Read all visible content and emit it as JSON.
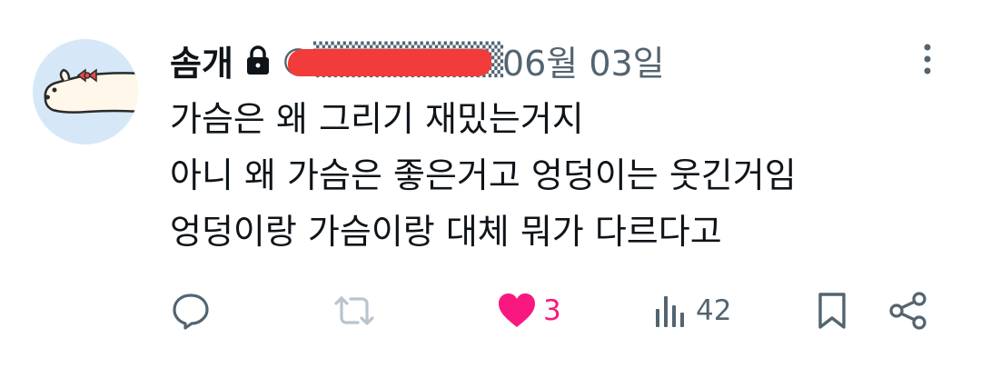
{
  "tweet": {
    "author_name": "솜개",
    "handle": "@▒▒▒▒▒▒▒▒",
    "date": "06월 03일",
    "lines": [
      "가슴은 왜 그리기 재밌는거지",
      "아니 왜 가슴은 좋은거고 엉덩이는 웃긴거임",
      "엉덩이랑 가슴이랑 대체 뭐가 다르다고"
    ]
  },
  "actions": {
    "likes": "3",
    "views": "42"
  },
  "icons": {
    "protected": "lock-icon",
    "more": "more-vertical-icon",
    "reply": "reply-icon",
    "retweet": "retweet-icon",
    "like": "heart-icon",
    "views": "views-chart-icon",
    "bookmark": "bookmark-icon",
    "share": "share-icon"
  },
  "colors": {
    "text": "#0f1419",
    "secondary": "#536471",
    "like": "#f91880",
    "avatar_bg": "#d6e8f7",
    "redaction": "#f23b3b"
  }
}
